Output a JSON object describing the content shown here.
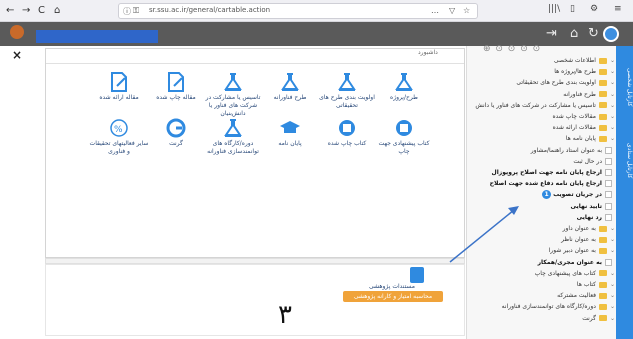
{
  "browser": {
    "back": "←",
    "forward": "→",
    "reload": "C",
    "home": "⌂",
    "url": "sr.ssu.ac.ir/general/cartable.action",
    "more": "…",
    "bookmark": "☆",
    "library": "|||\\",
    "reader": "▯",
    "ext": "⚙",
    "menu": "≡"
  },
  "header": {
    "logout_icon": "⇥",
    "home_icon": "⌂",
    "refresh_icon": "↻"
  },
  "panel": {
    "close": "×",
    "tab_dashboard": "داشبورد",
    "icons_row1": [
      {
        "label": "طرح/پروژه",
        "icon": "flask-icon"
      },
      {
        "label": "اولویت بندی طرح های تحقیقاتی",
        "icon": "flask-icon"
      },
      {
        "label": "طرح فناورانه",
        "icon": "flask-icon"
      },
      {
        "label": "تاسیس یا مشارکت در شرکت های فناور یا دانش‌بنیان",
        "icon": "flask-icon"
      },
      {
        "label": "مقاله چاپ شده",
        "icon": "doc-edit-icon"
      },
      {
        "label": "مقاله ارائه شده",
        "icon": "doc-edit-icon"
      }
    ],
    "icons_row2": [
      {
        "label": "کتاب پیشنهادی جهت چاپ",
        "icon": "book-icon"
      },
      {
        "label": "کتاب چاپ شده",
        "icon": "book-icon"
      },
      {
        "label": "پایان نامه",
        "icon": "graduation-icon"
      },
      {
        "label": "دوره/کارگاه های توانمندسازی فناورانه",
        "icon": "flask-icon"
      },
      {
        "label": "گرنت",
        "icon": "grant-icon"
      },
      {
        "label": "سایر فعالیتهای تحقیقات و فناوری",
        "icon": "percent-icon"
      }
    ],
    "lower_doc_label": "مستندات پژوهشی",
    "lower_button": "محاسبه امتیاز و کارانه پژوهشی",
    "big_number": "٣"
  },
  "tree": {
    "toolbar": "⊕ ⊙ ⊙ ⊙ ⊙",
    "items": [
      {
        "text": "اطلاعات شخصی",
        "kind": "folder"
      },
      {
        "text": "طرح ها/پروژه ها",
        "kind": "folder"
      },
      {
        "text": "اولویت بندی طرح های تحقیقاتی",
        "kind": "folder"
      },
      {
        "text": "طرح فناورانه",
        "kind": "folder"
      },
      {
        "text": "تاسیس یا مشارکت در شرکت های فناور یا دانش",
        "kind": "folder"
      },
      {
        "text": "مقالات چاپ شده",
        "kind": "folder"
      },
      {
        "text": "مقالات ارائه شده",
        "kind": "folder"
      },
      {
        "text": "پایان نامه ها",
        "kind": "folder"
      },
      {
        "text": "به عنوان استاد راهنما/مشاور",
        "kind": "check"
      },
      {
        "text": "در حال ثبت",
        "kind": "check"
      },
      {
        "text": "ارجاع پایان نامه جهت اصلاح پروپوزال",
        "kind": "check",
        "bold": true
      },
      {
        "text": "ارجاع پایان نامه دفاع شده جهت اصلاح",
        "kind": "check",
        "bold": true
      },
      {
        "text": "در جریان تصویب",
        "kind": "check",
        "bold": true,
        "badge": "1"
      },
      {
        "text": "تایید نهایی",
        "kind": "check",
        "bold": true
      },
      {
        "text": "رد نهایی",
        "kind": "check",
        "bold": true
      },
      {
        "text": "به عنوان داور",
        "kind": "folder"
      },
      {
        "text": "به عنوان ناظر",
        "kind": "folder"
      },
      {
        "text": "به عنوان دبیر شورا",
        "kind": "folder"
      },
      {
        "text": "به عنوان مجری/همکار",
        "kind": "check",
        "bold": true
      },
      {
        "text": "کتاب های پیشنهادی چاپ",
        "kind": "folder"
      },
      {
        "text": "کتاب ها",
        "kind": "folder"
      },
      {
        "text": "فعالیت مشترکه",
        "kind": "folder"
      },
      {
        "text": "دوره/کارگاه های توانمندسازی فناورانه",
        "kind": "folder"
      },
      {
        "text": "گرنت",
        "kind": "folder"
      }
    ]
  },
  "sidebar": {
    "tab1": "کارتابل شخصی",
    "tab2": "کارتابل ستادی"
  }
}
